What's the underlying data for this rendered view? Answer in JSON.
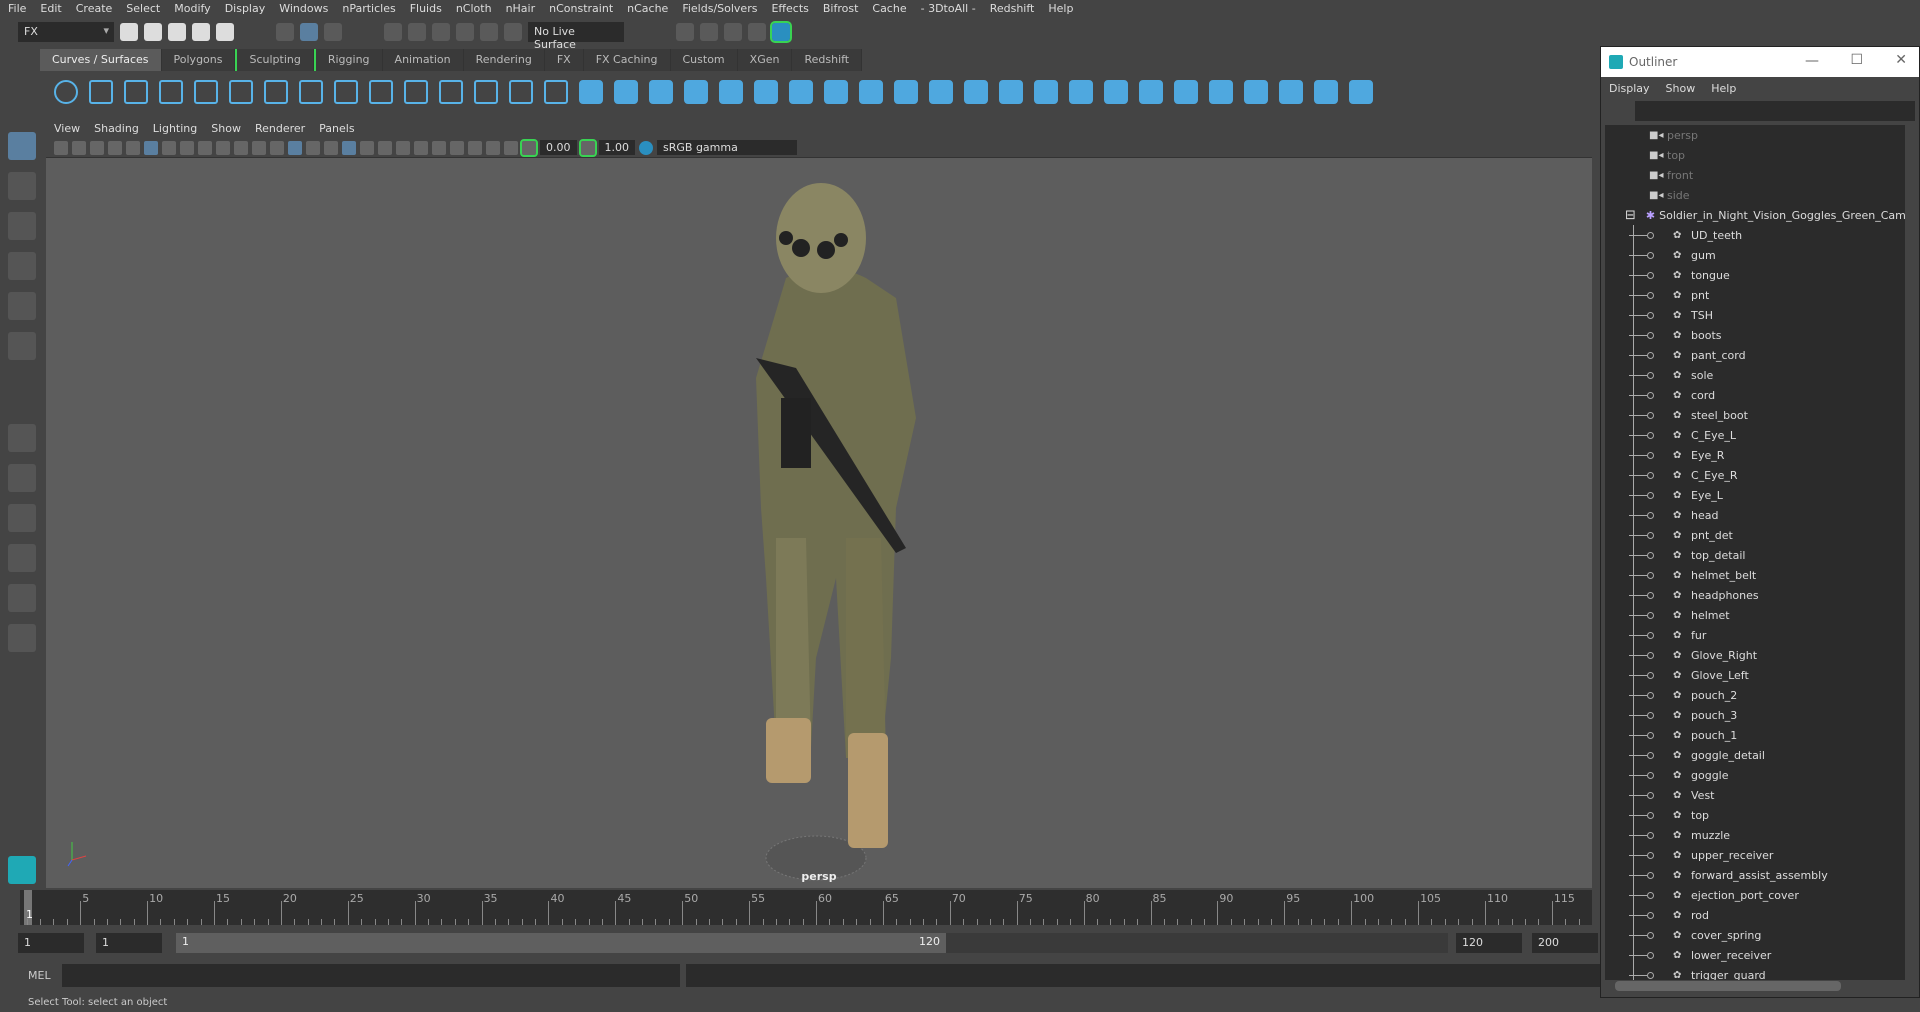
{
  "menubar": [
    "File",
    "Edit",
    "Create",
    "Select",
    "Modify",
    "Display",
    "Windows",
    "nParticles",
    "Fluids",
    "nCloth",
    "nHair",
    "nConstraint",
    "nCache",
    "Fields/Solvers",
    "Effects",
    "Bifrost",
    "Cache",
    "- 3DtoAll -",
    "Redshift",
    "Help"
  ],
  "toolbar": {
    "menu_set": "FX",
    "live_surface": "No Live Surface"
  },
  "shelf_tabs": [
    "Curves / Surfaces",
    "Polygons",
    "Sculpting",
    "Rigging",
    "Animation",
    "Rendering",
    "FX",
    "FX Caching",
    "Custom",
    "XGen",
    "Redshift"
  ],
  "viewport": {
    "menu": [
      "View",
      "Shading",
      "Lighting",
      "Show",
      "Renderer",
      "Panels"
    ],
    "exposure": "0.00",
    "gamma": "1.00",
    "color_space": "sRGB gamma",
    "camera_label": "persp"
  },
  "timeline": {
    "ticks": [
      "5",
      "10",
      "15",
      "20",
      "25",
      "30",
      "35",
      "40",
      "45",
      "50",
      "55",
      "60",
      "65",
      "70",
      "75",
      "80",
      "85",
      "90",
      "95",
      "100",
      "105",
      "110",
      "115"
    ],
    "current_frame": "1"
  },
  "range": {
    "start": "1",
    "playback_start": "1",
    "slider_start": "1",
    "slider_end": "120",
    "playback_end": "120",
    "end": "200"
  },
  "mel": {
    "label": "MEL"
  },
  "status": "Select Tool: select an object",
  "outliner": {
    "title": "Outliner",
    "menu": [
      "Display",
      "Show",
      "Help"
    ],
    "cameras": [
      "persp",
      "top",
      "front",
      "side"
    ],
    "root": "Soldier_in_Night_Vision_Goggles_Green_Camo_Vest",
    "items": [
      "UD_teeth",
      "gum",
      "tongue",
      "pnt",
      "TSH",
      "boots",
      "pant_cord",
      "sole",
      "cord",
      "steel_boot",
      "C_Eye_L",
      "Eye_R",
      "C_Eye_R",
      "Eye_L",
      "head",
      "pnt_det",
      "top_detail",
      "helmet_belt",
      "headphones",
      "helmet",
      "fur",
      "Glove_Right",
      "Glove_Left",
      "pouch_2",
      "pouch_3",
      "pouch_1",
      "goggle_detail",
      "goggle",
      "Vest",
      "top",
      "muzzle",
      "upper_receiver",
      "forward_assist_assembly",
      "ejection_port_cover",
      "rod",
      "cover_spring",
      "lower_receiver",
      "trigger_guard"
    ]
  },
  "colors": {
    "accent": "#4fa8df",
    "highlight": "#39d353"
  }
}
